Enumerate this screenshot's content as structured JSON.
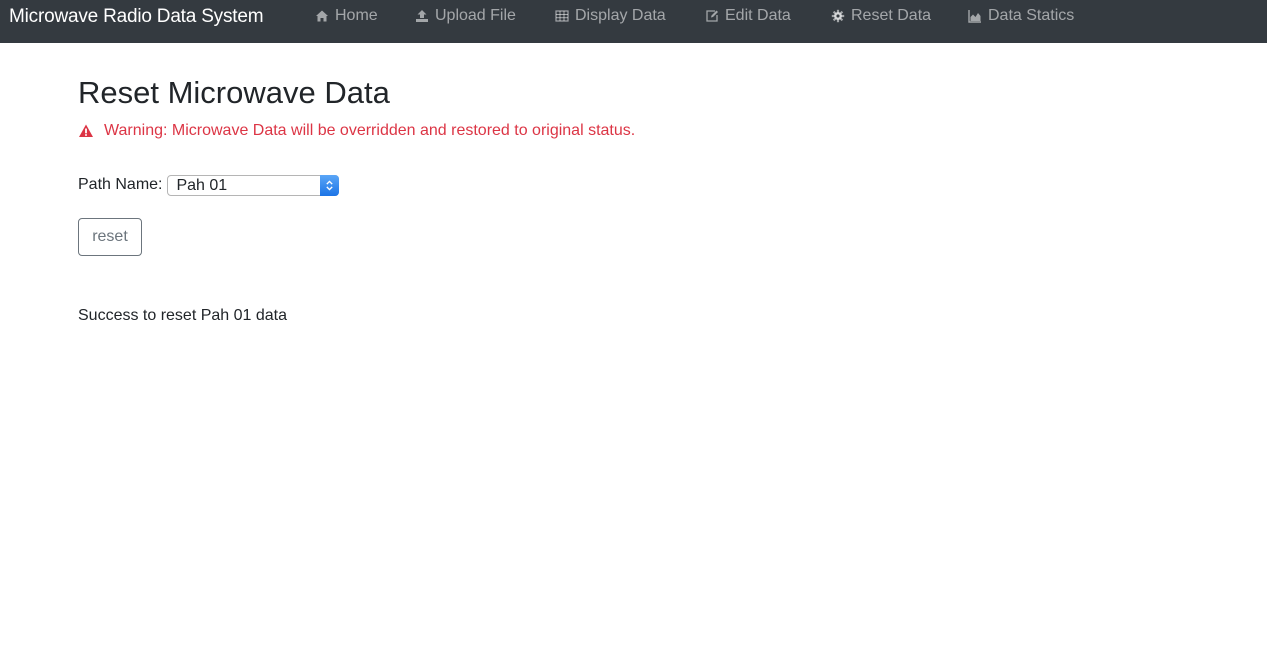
{
  "navbar": {
    "brand": "Microwave Radio Data System",
    "items": [
      {
        "label": "Home",
        "icon": "home-icon"
      },
      {
        "label": "Upload File",
        "icon": "upload-icon"
      },
      {
        "label": "Display Data",
        "icon": "table-icon"
      },
      {
        "label": "Edit Data",
        "icon": "edit-icon"
      },
      {
        "label": "Reset Data",
        "icon": "gear-icon"
      },
      {
        "label": "Data Statics",
        "icon": "area-chart-icon"
      }
    ]
  },
  "main": {
    "title": "Reset Microwave Data",
    "warning": {
      "icon": "warning-triangle-icon",
      "text": "Warning: Microwave Data will be overridden and restored to original status."
    },
    "path_field": {
      "label": "Path Name:",
      "selected": "Pah 01"
    },
    "reset_button": "reset",
    "status_message": "Success to reset Pah 01 data"
  },
  "colors": {
    "navbar_bg": "#343a40",
    "warning": "#dc3545",
    "button_border": "#6c757d"
  }
}
